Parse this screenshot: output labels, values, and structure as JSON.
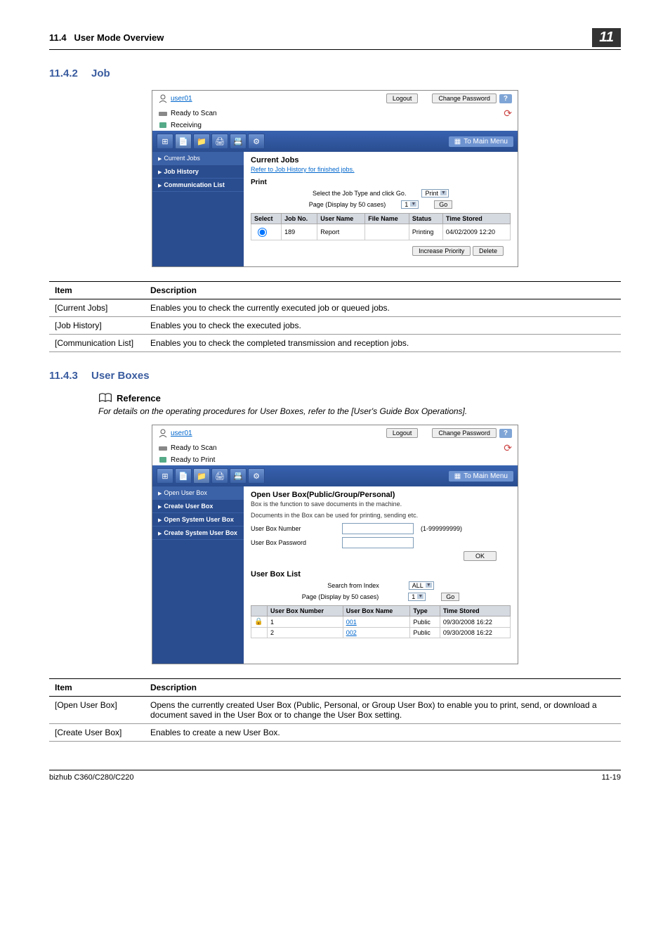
{
  "header": {
    "section": "11.4",
    "title": "User Mode Overview",
    "chapnum": "11"
  },
  "h_job": {
    "num": "11.4.2",
    "title": "Job"
  },
  "ss1": {
    "user": "user01",
    "btn_logout": "Logout",
    "btn_chpw": "Change Password",
    "status1": "Ready to Scan",
    "status2": "Receiving",
    "to_main": "To Main Menu",
    "side": {
      "current": "Current Jobs",
      "history": "Job History",
      "comm": "Communication List"
    },
    "content_title": "Current Jobs",
    "content_link": "Refer to Job History for finished jobs.",
    "sub": "Print",
    "sel_label": "Select the Job Type and click Go.",
    "page_label": "Page (Display by 50 cases)",
    "sel_val": "Print",
    "page_val": "1",
    "go": "Go",
    "th": {
      "select": "Select",
      "jobno": "Job No.",
      "uname": "User Name",
      "fname": "File Name",
      "status": "Status",
      "time": "Time Stored"
    },
    "row": {
      "jobno": "189",
      "uname": "Report",
      "fname": "",
      "status": "Printing",
      "time": "04/02/2009 12:20"
    },
    "btn_prio": "Increase Priority",
    "btn_del": "Delete"
  },
  "table1": {
    "h_item": "Item",
    "h_desc": "Description",
    "r1_item": "[Current Jobs]",
    "r1_desc": "Enables you to check the currently executed job or queued jobs.",
    "r2_item": "[Job History]",
    "r2_desc": "Enables you to check the executed jobs.",
    "r3_item": "[Communication List]",
    "r3_desc": "Enables you to check the completed transmission and reception jobs."
  },
  "h_ub": {
    "num": "11.4.3",
    "title": "User Boxes"
  },
  "ref": {
    "label": "Reference",
    "text": "For details on the operating procedures for User Boxes, refer to the [User's Guide Box Operations]."
  },
  "ss2": {
    "user": "user01",
    "btn_logout": "Logout",
    "btn_chpw": "Change Password",
    "status1": "Ready to Scan",
    "status2": "Ready to Print",
    "to_main": "To Main Menu",
    "side": {
      "open": "Open User Box",
      "create": "Create User Box",
      "opensys": "Open System User Box",
      "createsys": "Create System User Box"
    },
    "content_title": "Open User Box(Public/Group/Personal)",
    "desc1": "Box is the function to save documents in the machine.",
    "desc2": "Documents in the Box can be used for printing, sending etc.",
    "f1": "User Box Number",
    "f1_hint": "(1-999999999)",
    "f2": "User Box Password",
    "ok": "OK",
    "list_title": "User Box List",
    "search": "Search from Index",
    "search_val": "ALL",
    "page_label": "Page (Display by 50 cases)",
    "page_val": "1",
    "go": "Go",
    "th": {
      "num": "User Box Number",
      "name": "User Box Name",
      "type": "Type",
      "time": "Time Stored"
    },
    "r1": {
      "num": "1",
      "name": "001",
      "type": "Public",
      "time": "09/30/2008 16:22"
    },
    "r2": {
      "num": "2",
      "name": "002",
      "type": "Public",
      "time": "09/30/2008 16:22"
    }
  },
  "table2": {
    "h_item": "Item",
    "h_desc": "Description",
    "r1_item": "[Open User Box]",
    "r1_desc": "Opens the currently created User Box (Public, Personal, or Group User Box) to enable you to print, send, or download a document saved in the User Box or to change the User Box setting.",
    "r2_item": "[Create User Box]",
    "r2_desc": "Enables to create a new User Box."
  },
  "footer": {
    "model": "bizhub C360/C280/C220",
    "page": "11-19"
  }
}
